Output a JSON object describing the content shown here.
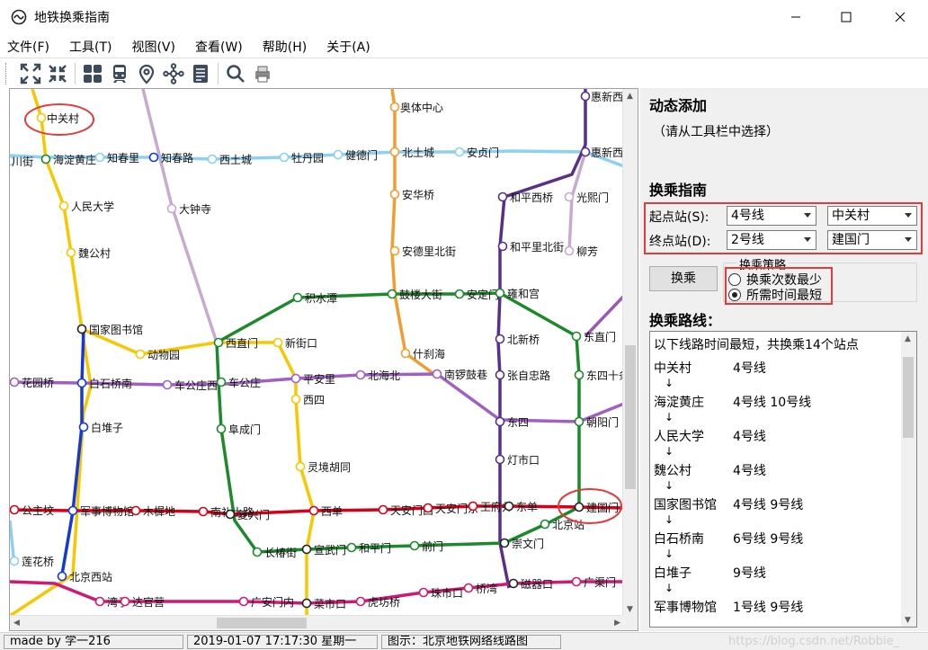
{
  "window": {
    "title": "地铁换乘指南",
    "app_icon": "metro-icon"
  },
  "menu": [
    "文件(F)",
    "工具(T)",
    "视图(V)",
    "查看(W)",
    "帮助(H)",
    "关于(A)"
  ],
  "toolbar": [
    "expand-icon",
    "collapse-icon",
    "grid-icon",
    "train-icon",
    "location-pin-icon",
    "network-icon",
    "document-icon",
    "search-icon",
    "print-icon"
  ],
  "colors": {
    "line1": "#d4000f",
    "line2": "#1f4fa0",
    "line4": "#00a0c6",
    "line5": "#a5239a",
    "line6": "#b5890c",
    "line7": "#f6c4a4",
    "line8": "#118b3c",
    "line9": "#8fc31f",
    "line10": "#009bc1",
    "line13": "#f6d616",
    "highlight": "#e33b3b"
  },
  "map": {
    "stations": [
      {
        "label": "中关村"
      },
      {
        "label": "奥体中心"
      },
      {
        "label": "惠新西"
      },
      {
        "label": "川街"
      },
      {
        "label": "海淀黄庄"
      },
      {
        "label": "知春里"
      },
      {
        "label": "知春路"
      },
      {
        "label": "西土城"
      },
      {
        "label": "牡丹园"
      },
      {
        "label": "健德门"
      },
      {
        "label": "北土城"
      },
      {
        "label": "安贞门"
      },
      {
        "label": "惠新西"
      },
      {
        "label": "人民大学"
      },
      {
        "label": "大钟寺"
      },
      {
        "label": "安华桥"
      },
      {
        "label": "和平西桥"
      },
      {
        "label": "光熙门"
      },
      {
        "label": "魏公村"
      },
      {
        "label": "安德里北街"
      },
      {
        "label": "和平里北街"
      },
      {
        "label": "柳芳"
      },
      {
        "label": "积水潭"
      },
      {
        "label": "鼓楼大街"
      },
      {
        "label": "安定门"
      },
      {
        "label": "雍和宫"
      },
      {
        "label": "国家图书馆"
      },
      {
        "label": "西直门"
      },
      {
        "label": "新街口"
      },
      {
        "label": "北新桥"
      },
      {
        "label": "东直门"
      },
      {
        "label": "动物园"
      },
      {
        "label": "什刹海"
      },
      {
        "label": "花园桥"
      },
      {
        "label": "白石桥南"
      },
      {
        "label": "车公庄西"
      },
      {
        "label": "车公庄"
      },
      {
        "label": "平安里"
      },
      {
        "label": "北海北"
      },
      {
        "label": "南锣鼓巷"
      },
      {
        "label": "张自忠路"
      },
      {
        "label": "东四十条"
      },
      {
        "label": "西四"
      },
      {
        "label": "白堆子"
      },
      {
        "label": "阜成门"
      },
      {
        "label": "东四"
      },
      {
        "label": "朝阳门"
      },
      {
        "label": "灵境胡同"
      },
      {
        "label": "灯市口"
      },
      {
        "label": "公主坟"
      },
      {
        "label": "军事博物馆"
      },
      {
        "label": "木樨地"
      },
      {
        "label": "南礼士路"
      },
      {
        "label": "复兴门"
      },
      {
        "label": "西单"
      },
      {
        "label": "天安门西"
      },
      {
        "label": "天安门东"
      },
      {
        "label": "王府井"
      },
      {
        "label": "东单"
      },
      {
        "label": "建国门"
      },
      {
        "label": "北京站"
      },
      {
        "label": "长椿街"
      },
      {
        "label": "宣武门"
      },
      {
        "label": "和平门"
      },
      {
        "label": "前门"
      },
      {
        "label": "崇文门"
      },
      {
        "label": "莲花桥"
      },
      {
        "label": "北京西站"
      },
      {
        "label": "湾子"
      },
      {
        "label": "达官营"
      },
      {
        "label": "广安门内"
      },
      {
        "label": "菜市口"
      },
      {
        "label": "虎坊桥"
      },
      {
        "label": "珠市口"
      },
      {
        "label": "桥湾"
      },
      {
        "label": "磁器口"
      },
      {
        "label": "广渠门"
      }
    ]
  },
  "panel": {
    "dynamic_title": "动态添加",
    "dynamic_hint": "（请从工具栏中选择）",
    "guide_title": "换乘指南",
    "start_label": "起点站(S):",
    "end_label": "终点站(D):",
    "start_line": "4号线",
    "start_station": "中关村",
    "end_line": "2号线",
    "end_station": "建国门",
    "transfer_button": "换乘",
    "strategy_label": "换乘策略",
    "option_fewest": "换乘次数最少",
    "option_fastest": "所需时间最短",
    "selected_option": "fastest",
    "route_title": "换乘路线：",
    "route_summary": "以下线路时间最短，共换乘14个站点",
    "route": [
      {
        "station": "中关村",
        "lines": "4号线"
      },
      {
        "station": "海淀黄庄",
        "lines": "4号线 10号线"
      },
      {
        "station": "人民大学",
        "lines": "4号线"
      },
      {
        "station": "魏公村",
        "lines": "4号线"
      },
      {
        "station": "国家图书馆",
        "lines": "4号线 9号线"
      },
      {
        "station": "白石桥南",
        "lines": "6号线 9号线"
      },
      {
        "station": "白堆子",
        "lines": "9号线"
      },
      {
        "station": "军事博物馆",
        "lines": "1号线 9号线"
      }
    ]
  },
  "status": {
    "author": "made by 学一216",
    "datetime": "2019-01-07 17:17:30 星期一",
    "caption": "图示：北京地铁网络线路图",
    "watermark": "https://blog.csdn.net/Robbie_"
  }
}
